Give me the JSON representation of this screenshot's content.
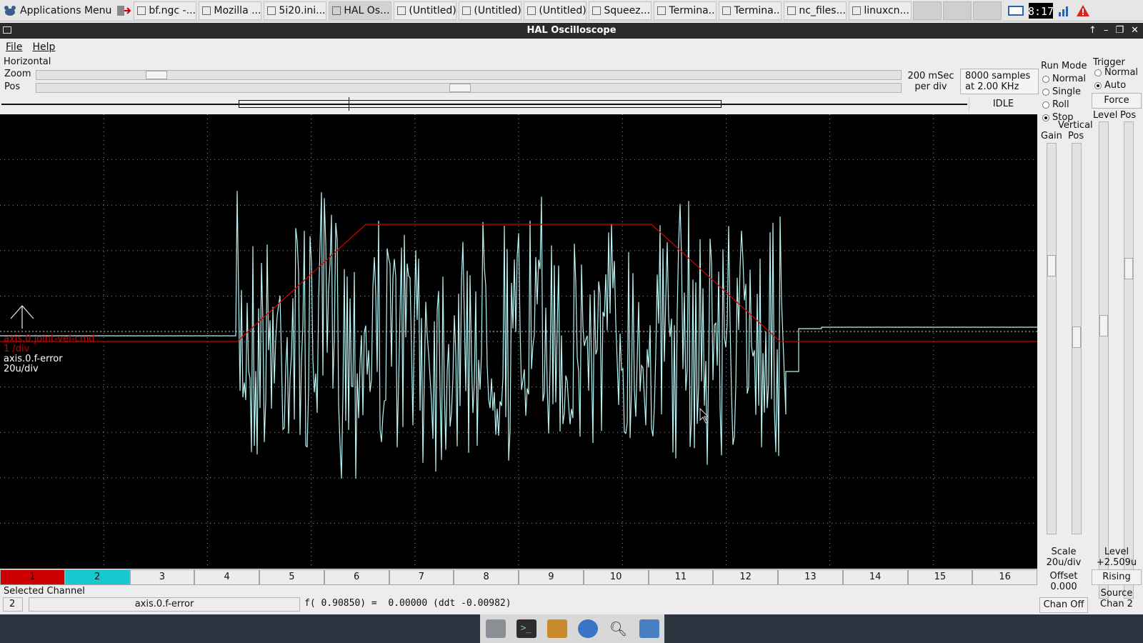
{
  "taskbar": {
    "app_menu": "Applications Menu",
    "tasks": [
      {
        "label": "bf.ngc -...",
        "icon": "x-icon"
      },
      {
        "label": "Mozilla ...",
        "icon": "firefox-icon"
      },
      {
        "label": "5i20.ini...",
        "icon": "editor-icon"
      },
      {
        "label": "HAL Os...",
        "icon": "window-icon",
        "active": true
      },
      {
        "label": "(Untitled)",
        "icon": "window-icon"
      },
      {
        "label": "(Untitled)",
        "icon": "window-icon"
      },
      {
        "label": "(Untitled)",
        "icon": "window-icon"
      },
      {
        "label": "Squeez...",
        "icon": "squeeze-icon"
      },
      {
        "label": "Termina...",
        "icon": "terminal-icon"
      },
      {
        "label": "Termina...",
        "icon": "terminal-icon"
      },
      {
        "label": "nc_files...",
        "icon": "folder-icon"
      },
      {
        "label": "linuxcn...",
        "icon": "folder-icon"
      }
    ]
  },
  "window": {
    "title": "HAL Oscilloscope"
  },
  "menu": {
    "file": "File",
    "help": "Help"
  },
  "horizontal": {
    "title": "Horizontal",
    "zoom_label": "Zoom",
    "pos_label": "Pos",
    "zoom_value": 0.13,
    "pos_value": 0.49,
    "per_div_line1": "200 mSec",
    "per_div_line2": "per div",
    "samples_line1": "8000 samples",
    "samples_line2": "at 2.00 KHz",
    "state": "IDLE"
  },
  "scope": {
    "ch1_name": "axis.0.joint-vel-cmd",
    "ch1_scale": "1 /div",
    "ch2_name": "axis.0.f-error",
    "ch2_scale": "20u/div",
    "colors": {
      "ch1": "#cc0000",
      "ch2": "#b8f4f4",
      "grid": "#9a9a9a"
    }
  },
  "run_mode": {
    "title": "Run Mode",
    "options": [
      "Normal",
      "Single",
      "Roll",
      "Stop"
    ],
    "selected": "Stop"
  },
  "trigger": {
    "title": "Trigger",
    "options": [
      "Normal",
      "Auto"
    ],
    "selected": "Auto",
    "force": "Force",
    "level_label": "Level",
    "pos_label": "Pos",
    "level_value_label": "Level",
    "level_value": "+2.509u",
    "edge": "Rising",
    "source_label": "Source",
    "source_value": "Chan  2"
  },
  "vertical": {
    "title": "Vertical",
    "gain_label": "Gain",
    "pos_label": "Pos",
    "scale_label": "Scale",
    "scale_value": "20u/div",
    "offset_label": "Offset",
    "offset_value": "0.000",
    "chan_off": "Chan Off"
  },
  "channels": [
    "1",
    "2",
    "3",
    "4",
    "5",
    "6",
    "7",
    "8",
    "9",
    "10",
    "11",
    "12",
    "13",
    "14",
    "15",
    "16"
  ],
  "selected_channel": {
    "title": "Selected Channel",
    "number": "2",
    "name": "axis.0.f-error",
    "readout": "f( 0.90850) =  0.00000 (ddt -0.00982)"
  }
}
